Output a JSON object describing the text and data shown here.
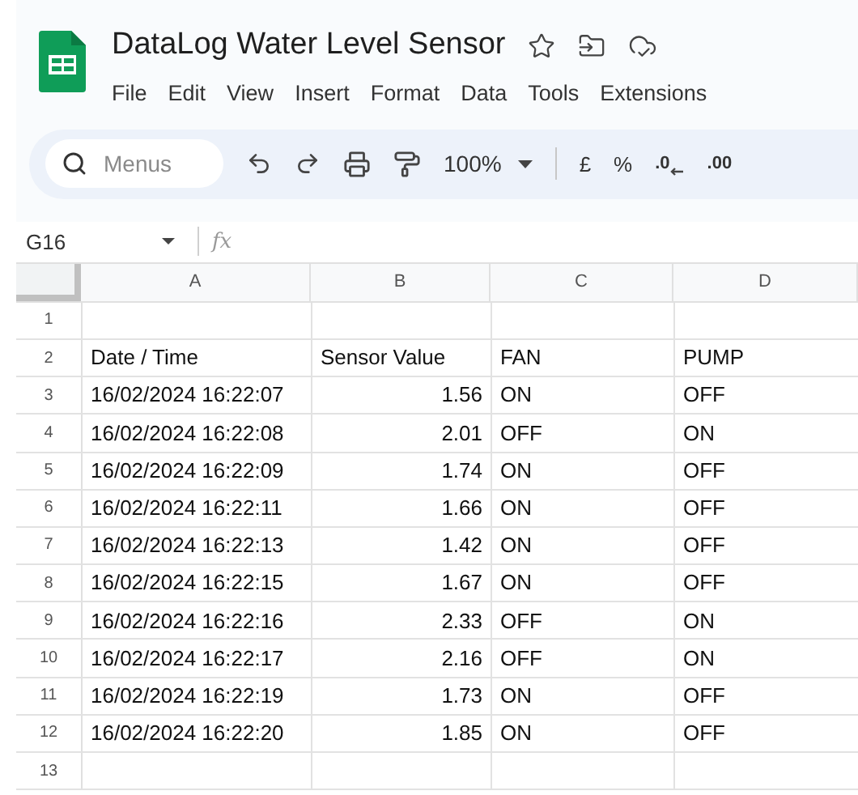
{
  "document": {
    "title": "DataLog Water Level Sensor"
  },
  "menu": [
    "File",
    "Edit",
    "View",
    "Insert",
    "Format",
    "Data",
    "Tools",
    "Extensions"
  ],
  "toolbar": {
    "search_placeholder": "Menus",
    "zoom": "100%",
    "currency": "£",
    "percent": "%",
    "decrease_decimals": ".0",
    "increase_decimals": ".00"
  },
  "formula_bar": {
    "cell_ref": "G16",
    "fx": "fx"
  },
  "sheet": {
    "columns": [
      "A",
      "B",
      "C",
      "D"
    ],
    "rows": [
      {
        "number": "1",
        "kind": "empty",
        "cells": []
      },
      {
        "number": "2",
        "kind": "header",
        "cells": [
          "Date / Time",
          "Sensor Value",
          "FAN",
          "PUMP"
        ]
      },
      {
        "number": "3",
        "kind": "data",
        "cells": [
          "16/02/2024 16:22:07",
          "1.56",
          "ON",
          "OFF"
        ]
      },
      {
        "number": "4",
        "kind": "data",
        "cells": [
          "16/02/2024 16:22:08",
          "2.01",
          "OFF",
          "ON"
        ]
      },
      {
        "number": "5",
        "kind": "data",
        "cells": [
          "16/02/2024 16:22:09",
          "1.74",
          "ON",
          "OFF"
        ]
      },
      {
        "number": "6",
        "kind": "data",
        "cells": [
          "16/02/2024 16:22:11",
          "1.66",
          "ON",
          "OFF"
        ]
      },
      {
        "number": "7",
        "kind": "data",
        "cells": [
          "16/02/2024 16:22:13",
          "1.42",
          "ON",
          "OFF"
        ]
      },
      {
        "number": "8",
        "kind": "data",
        "cells": [
          "16/02/2024 16:22:15",
          "1.67",
          "ON",
          "OFF"
        ]
      },
      {
        "number": "9",
        "kind": "data",
        "cells": [
          "16/02/2024 16:22:16",
          "2.33",
          "OFF",
          "ON"
        ]
      },
      {
        "number": "10",
        "kind": "data",
        "cells": [
          "16/02/2024 16:22:17",
          "2.16",
          "OFF",
          "ON"
        ]
      },
      {
        "number": "11",
        "kind": "data",
        "cells": [
          "16/02/2024 16:22:19",
          "1.73",
          "ON",
          "OFF"
        ]
      },
      {
        "number": "12",
        "kind": "data",
        "cells": [
          "16/02/2024 16:22:20",
          "1.85",
          "ON",
          "OFF"
        ]
      },
      {
        "number": "13",
        "kind": "empty",
        "cells": []
      }
    ]
  }
}
